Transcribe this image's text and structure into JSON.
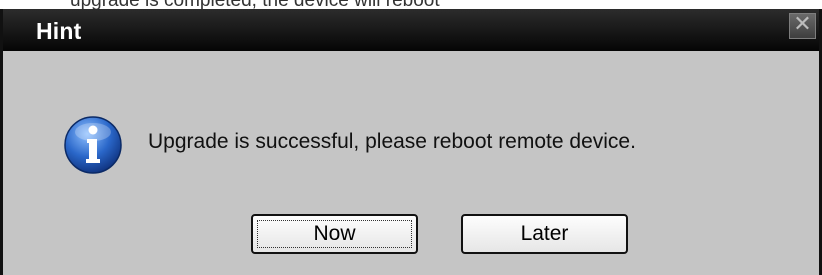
{
  "caption_fragment": "upgrade is completed, the device will reboot",
  "dialog": {
    "title": "Hint",
    "close_glyph": "✕",
    "message": "Upgrade is successful, please reboot remote device.",
    "icon": "info-icon",
    "buttons": {
      "now_label": "Now",
      "later_label": "Later"
    }
  },
  "colors": {
    "titlebar": "#0a0a0a",
    "body": "#c5c5c5",
    "icon_blue": "#2a67c9"
  }
}
